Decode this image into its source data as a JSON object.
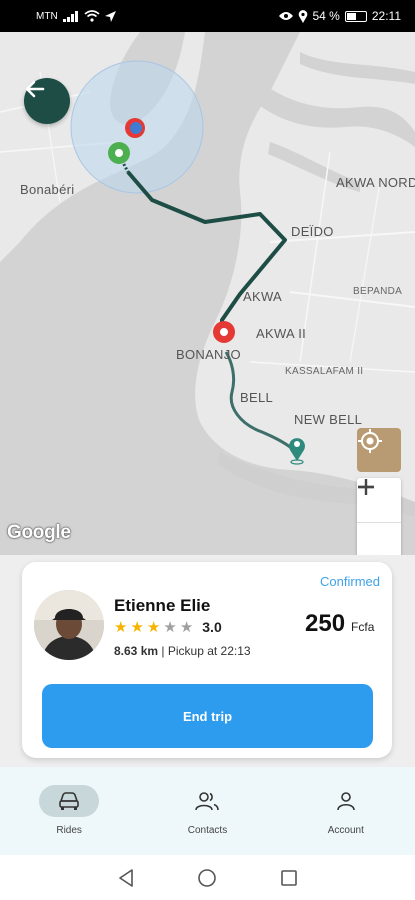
{
  "status_bar": {
    "carrier": "MTN",
    "battery_percent": "54 %",
    "time": "22:11",
    "battery_level": 0.54
  },
  "map": {
    "labels": {
      "bonaberi": "Bonabéri",
      "akwa_nord": "AKWA NORD",
      "deido": "DEÏDO",
      "bepanda": "BEPANDA",
      "akwa": "AKWA",
      "akwa_ii": "AKWA II",
      "bonanjo": "BONANJO",
      "kassalafam": "KASSALAFAM II",
      "bell": "BELL",
      "new_bell": "NEW BELL"
    },
    "attribution": "Google",
    "route_color": "#1d4d45",
    "accent": "#1d4d45"
  },
  "trip_card": {
    "status": "Confirmed",
    "driver_name": "Etienne Elie",
    "rating": "3.0",
    "stars_filled": 3,
    "stars_total": 5,
    "distance": "8.63 km",
    "pickup": "Pickup at 22:13",
    "price": "250",
    "currency": "Fcfa",
    "end_trip_label": "End trip"
  },
  "bottom_nav": {
    "items": [
      {
        "label": "Rides",
        "icon": "car-icon",
        "active": true
      },
      {
        "label": "Contacts",
        "icon": "contacts-icon",
        "active": false
      },
      {
        "label": "Account",
        "icon": "account-icon",
        "active": false
      }
    ]
  }
}
